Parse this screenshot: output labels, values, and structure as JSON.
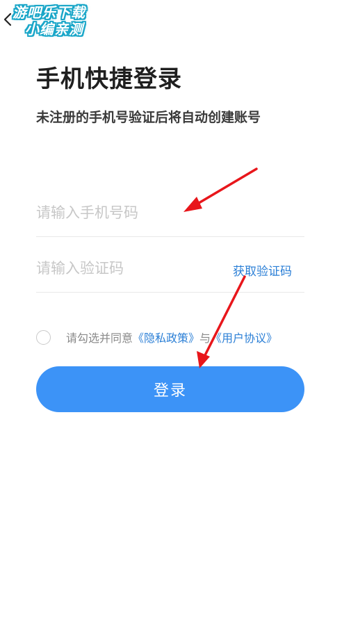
{
  "watermark": {
    "line1": "游吧乐下载",
    "line2": "小编亲测"
  },
  "header": {
    "back_icon": "chevron-left-icon"
  },
  "title": "手机快捷登录",
  "subtitle": "未注册的手机号验证后将自动创建账号",
  "phone_input": {
    "value": "",
    "placeholder": "请输入手机号码"
  },
  "code_input": {
    "value": "",
    "placeholder": "请输入验证码"
  },
  "get_code_label": "获取验证码",
  "agreement": {
    "checked": false,
    "prefix": "请勾选并同意",
    "privacy_link": "《隐私政策》",
    "connector": "与",
    "user_link": "《用户协议》"
  },
  "login_label": "登录",
  "colors": {
    "accent": "#3c93f7",
    "link": "#2b7fd6",
    "annotation_arrow": "#e8161b"
  }
}
